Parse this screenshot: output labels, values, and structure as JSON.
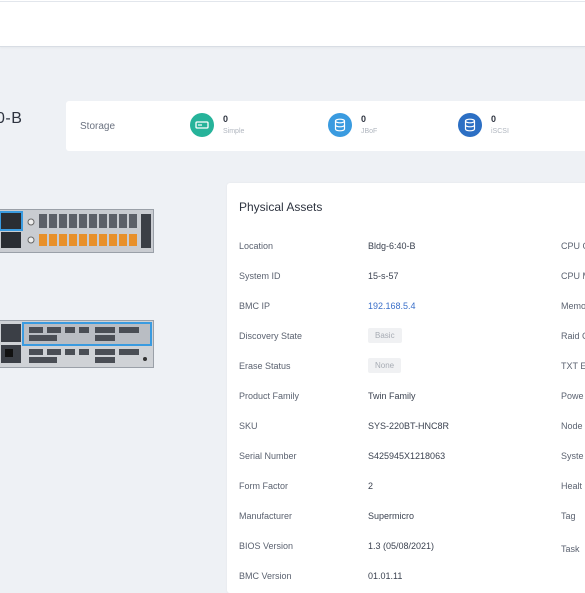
{
  "page": {
    "title": "0-B"
  },
  "storage": {
    "label": "Storage",
    "items": [
      {
        "count": "0",
        "name": "Simple",
        "color": "#26b39a",
        "icon": "drive-icon"
      },
      {
        "count": "0",
        "name": "JBoF",
        "color": "#3a9be0",
        "icon": "database-icon"
      },
      {
        "count": "0",
        "name": "iSCSI",
        "color": "#2c6fc4",
        "icon": "database-icon"
      }
    ]
  },
  "physical_assets": {
    "title": "Physical Assets",
    "rows": [
      {
        "label": "Location",
        "value": "Bldg-6:40-B",
        "right": "CPU C"
      },
      {
        "label": "System ID",
        "value": "15-s-57",
        "right": "CPU M"
      },
      {
        "label": "BMC IP",
        "value": "192.168.5.4",
        "right": "Memo"
      },
      {
        "label": "Discovery State",
        "value": "Basic",
        "right": "Raid C"
      },
      {
        "label": "Erase Status",
        "value": "None",
        "right": "TXT En"
      },
      {
        "label": "Product Family",
        "value": "Twin Family",
        "right": "Powe"
      },
      {
        "label": "SKU",
        "value": "SYS-220BT-HNC8R",
        "right": "Node"
      },
      {
        "label": "Serial Number",
        "value": "S425945X1218063",
        "right": "Syste"
      },
      {
        "label": "Form Factor",
        "value": "2",
        "right": "Healt"
      },
      {
        "label": "Manufacturer",
        "value": "Supermicro",
        "right": "Tag"
      },
      {
        "label": "BIOS Version",
        "value": "1.3 (05/08/2021)",
        "right": "Task"
      },
      {
        "label": "BMC Version",
        "value": "01.01.11",
        "right": ""
      }
    ]
  }
}
